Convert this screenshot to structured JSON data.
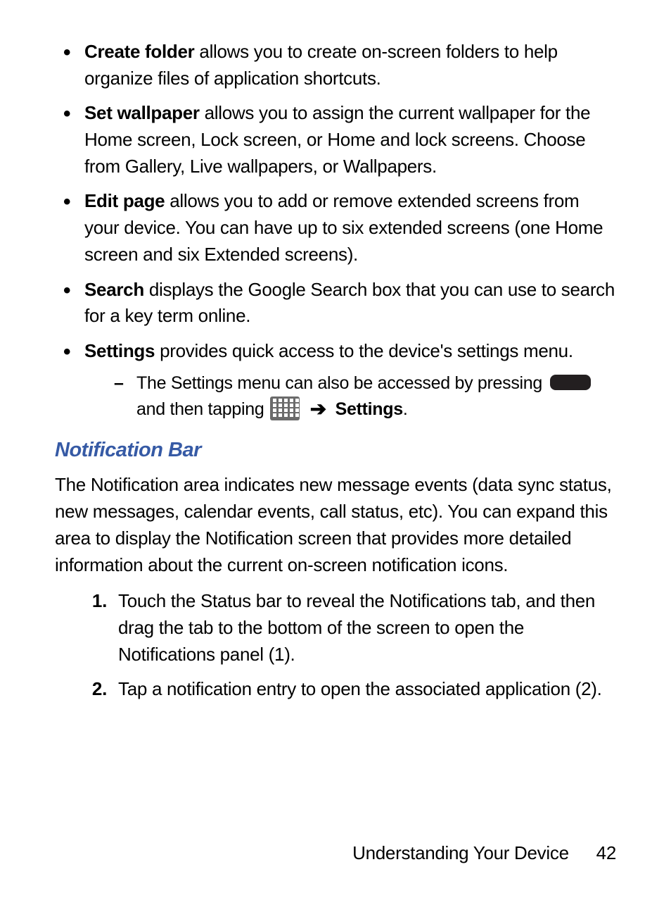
{
  "bullets": [
    {
      "term": "Create folder",
      "desc": " allows you to create on-screen folders to help organize files of application shortcuts."
    },
    {
      "term": "Set wallpaper",
      "desc": " allows you to assign the current wallpaper for the Home screen, Lock screen, or Home and lock screens. Choose from Gallery, Live wallpapers, or Wallpapers."
    },
    {
      "term": "Edit page",
      "desc": " allows you to add or remove extended screens from your device. You can have up to six extended screens (one Home screen and six Extended screens)."
    },
    {
      "term": "Search",
      "desc": " displays the Google Search box that you can use to search for a key term online."
    },
    {
      "term": "Settings",
      "desc": " provides quick access to the device's settings menu."
    }
  ],
  "sub": {
    "lead": "The Settings menu can also be accessed by pressing ",
    "mid": " and then tapping ",
    "arrow": "➔",
    "target": "Settings",
    "period": "."
  },
  "section_heading": "Notification Bar",
  "section_para": "The Notification area indicates new message events (data sync status, new messages, calendar events, call status, etc). You can expand this area to display the Notification screen that provides more detailed information about the current on-screen notification icons.",
  "steps": [
    {
      "num": "1.",
      "text": "Touch the Status bar to reveal the Notifications tab, and then drag the tab to the bottom of the screen to open the Notifications panel (1)."
    },
    {
      "num": "2.",
      "text": "Tap a notification entry to open the associated application (2)."
    }
  ],
  "footer": {
    "section": "Understanding Your Device",
    "page": "42"
  }
}
